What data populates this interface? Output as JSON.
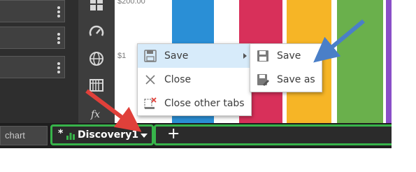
{
  "chart": {
    "axis_top": "$200.00",
    "axis_mid": "$1",
    "bar_colors": [
      "#2a8fd6",
      "#d8305a",
      "#f6b526",
      "#6ab04c",
      "#8a4fc8"
    ]
  },
  "tabs": {
    "search_text": "chart",
    "active_modified_marker": "*",
    "active_label": "Discovery1",
    "new_tab_label": "+"
  },
  "context_menu": {
    "items": [
      {
        "label": "Save",
        "icon": "save-icon"
      },
      {
        "label": "Close",
        "icon": "close-icon"
      },
      {
        "label": "Close other tabs",
        "icon": "close-other-tabs-icon"
      }
    ]
  },
  "save_submenu": {
    "items": [
      {
        "label": "Save",
        "icon": "save-icon"
      },
      {
        "label": "Save as",
        "icon": "save-as-icon"
      }
    ]
  },
  "icon_strip": [
    "dashboard-icon",
    "gauge-icon",
    "globe-icon",
    "table-icon",
    "function-icon"
  ],
  "accent_color": "#37b44a",
  "annotation_color_red": "#e0403a",
  "annotation_color_blue": "#4a7fc8"
}
